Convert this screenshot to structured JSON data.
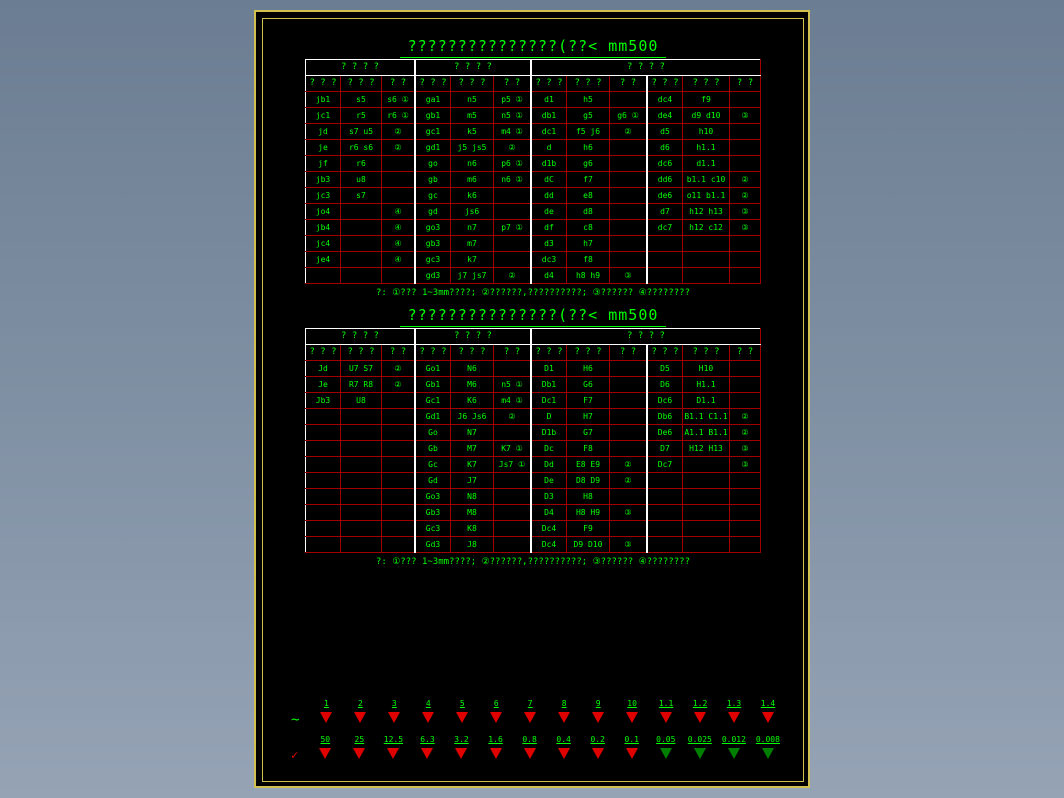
{
  "title1": "???????????????(??<   mm500",
  "title2": "???????????????(??<   mm500",
  "note1": "?: ①??? 1~3mm????;   ②??????,??????????;    ③??????   ④????????",
  "note2": "?: ①??? 1~3mm????;   ②??????,??????????;    ③??????   ④????????",
  "topHdr": [
    "? ? ? ?",
    "? ? ? ?",
    "?   ?   ?   ?"
  ],
  "subHdr": [
    "? ? ?",
    "? ? ?",
    "? ?",
    "? ? ?",
    "? ? ?",
    "? ?",
    "? ? ?",
    "? ? ?",
    "? ?",
    "? ? ?",
    "? ? ?",
    "? ?"
  ],
  "table1": [
    [
      "jb1",
      "s5",
      "s6 ①",
      "ga1",
      "n5",
      "p5 ①",
      "d1",
      "h5",
      "",
      "dc4",
      "f9",
      ""
    ],
    [
      "jc1",
      "r5",
      "r6 ①",
      "gb1",
      "m5",
      "n5 ①",
      "db1",
      "g5",
      "g6 ①",
      "de4",
      "d9 d10",
      "③"
    ],
    [
      "jd",
      "s7 u5",
      "②",
      "gc1",
      "k5",
      "m4 ①",
      "dc1",
      "f5 j6",
      "②",
      "d5",
      "h10",
      ""
    ],
    [
      "je",
      "r6 s6",
      "②",
      "gd1",
      "j5 js5",
      "②",
      "d",
      "h6",
      "",
      "d6",
      "h1.1",
      ""
    ],
    [
      "jf",
      "r6",
      "",
      "go",
      "n6",
      "p6 ①",
      "d1b",
      "g6",
      "",
      "dc6",
      "d1.1",
      ""
    ],
    [
      "jb3",
      "u8",
      "",
      "gb",
      "m6",
      "n6 ①",
      "dC",
      "f7",
      "",
      "dd6",
      "b1.1 c10",
      "②"
    ],
    [
      "jc3",
      "s7",
      "",
      "gc",
      "k6",
      "",
      "dd",
      "e8",
      "",
      "de6",
      "o11 b1.1",
      "②"
    ],
    [
      "jo4",
      "",
      "④",
      "gd",
      "js6",
      "",
      "de",
      "d8",
      "",
      "d7",
      "h12 h13",
      "③"
    ],
    [
      "jb4",
      "",
      "④",
      "go3",
      "n7",
      "p7 ①",
      "df",
      "c8",
      "",
      "dc7",
      "h12 c12",
      "③"
    ],
    [
      "jc4",
      "",
      "④",
      "gb3",
      "m7",
      "",
      "d3",
      "h7",
      "",
      "",
      "",
      ""
    ],
    [
      "je4",
      "",
      "④",
      "gc3",
      "k7",
      "",
      "dc3",
      "f8",
      "",
      "",
      "",
      ""
    ],
    [
      "",
      "",
      "",
      "gd3",
      "j7 js7",
      "②",
      "d4",
      "h8 h9",
      "③",
      "",
      "",
      ""
    ]
  ],
  "table2": [
    [
      "Jd",
      "U7 S7",
      "②",
      "Go1",
      "N6",
      "",
      "D1",
      "H6",
      "",
      "D5",
      "H10",
      ""
    ],
    [
      "Je",
      "R7 R8",
      "②",
      "Gb1",
      "M6",
      "n5 ①",
      "Db1",
      "G6",
      "",
      "D6",
      "H1.1",
      ""
    ],
    [
      "Jb3",
      "U8",
      "",
      "Gc1",
      "K6",
      "m4 ①",
      "Dc1",
      "F7",
      "",
      "Dc6",
      "D1.1",
      ""
    ],
    [
      "",
      "",
      "",
      "Gd1",
      "J6 Js6",
      "②",
      "D",
      "H7",
      "",
      "Db6",
      "B1.1 C1.1",
      "②"
    ],
    [
      "",
      "",
      "",
      "Go",
      "N7",
      "",
      "D1b",
      "G7",
      "",
      "De6",
      "A1.1 B1.1",
      "②"
    ],
    [
      "",
      "",
      "",
      "Gb",
      "M7",
      "K7 ①",
      "Dc",
      "F8",
      "",
      "D7",
      "H12 H13",
      "③"
    ],
    [
      "",
      "",
      "",
      "Gc",
      "K7",
      "Js7 ①",
      "Dd",
      "E8 E9",
      "②",
      "Dc7",
      "",
      "③"
    ],
    [
      "",
      "",
      "",
      "Gd",
      "J7",
      "",
      "De",
      "D8 D9",
      "②",
      "",
      "",
      ""
    ],
    [
      "",
      "",
      "",
      "Go3",
      "N8",
      "",
      "D3",
      "H8",
      "",
      "",
      "",
      ""
    ],
    [
      "",
      "",
      "",
      "Gb3",
      "M8",
      "",
      "D4",
      "H8 H9",
      "③",
      "",
      "",
      ""
    ],
    [
      "",
      "",
      "",
      "Gc3",
      "K8",
      "",
      "Dc4",
      "F9",
      "",
      "",
      "",
      ""
    ],
    [
      "",
      "",
      "",
      "Gd3",
      "J8",
      "",
      "Dc4",
      "D9 D10",
      "③",
      "",
      "",
      ""
    ]
  ],
  "scale1": [
    "1",
    "2",
    "3",
    "4",
    "5",
    "6",
    "7",
    "8",
    "9",
    "10",
    "1.1",
    "1.2",
    "1.3",
    "1.4"
  ],
  "scale2": [
    "50",
    "25",
    "12.5",
    "6.3",
    "3.2",
    "1.6",
    "0.8",
    "0.4",
    "0.2",
    "0.1",
    "0.05",
    "0.025",
    "0.012",
    "0.008"
  ]
}
